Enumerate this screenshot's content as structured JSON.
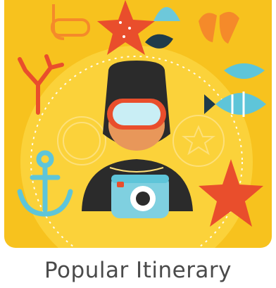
{
  "card": {
    "caption": "Popular Itinerary",
    "illustration": {
      "icons": [
        "snorkel-mask-icon",
        "starfish-icon",
        "seashell-icon",
        "flippers-icon",
        "coral-icon",
        "tropical-fish-icon",
        "anchor-icon",
        "diver-icon",
        "underwater-camera-icon",
        "seal-badge-icon",
        "star-badge-icon"
      ],
      "colors": {
        "background": "#f7c21e",
        "glow": "#fbd23a",
        "accent_orange": "#f58a2a",
        "coral_red": "#e94e2c",
        "teal": "#5ec5d9",
        "wetsuit": "#2b2b2b",
        "skin": "#e8975a",
        "camera": "#7fd0e0"
      }
    }
  }
}
